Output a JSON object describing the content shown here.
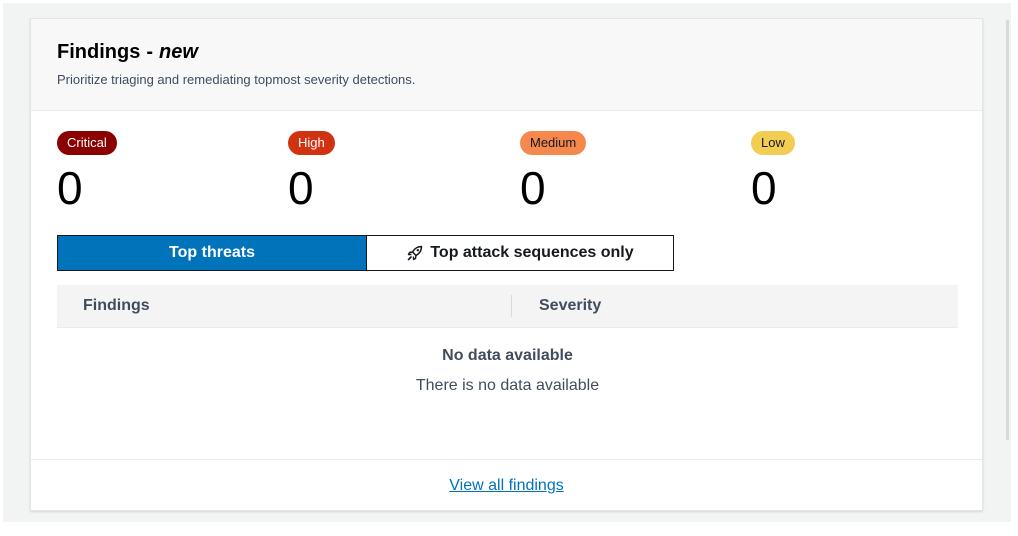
{
  "card": {
    "title": "Findings",
    "title_separator": "-",
    "title_badge": "new",
    "description": "Prioritize triaging and remediating topmost severity detections."
  },
  "severity_counts": [
    {
      "label": "Critical",
      "count": "0",
      "badge_bg": "#8b0000",
      "badge_fg": "#ffffff"
    },
    {
      "label": "High",
      "count": "0",
      "badge_bg": "#d13212",
      "badge_fg": "#ffffff"
    },
    {
      "label": "Medium",
      "count": "0",
      "badge_bg": "#f4884d",
      "badge_fg": "#16191f"
    },
    {
      "label": "Low",
      "count": "0",
      "badge_bg": "#f2cd54",
      "badge_fg": "#16191f"
    }
  ],
  "tabs": [
    {
      "label": "Top threats",
      "active": true
    },
    {
      "label": "Top attack sequences only",
      "active": false,
      "icon": "rocket-icon"
    }
  ],
  "table": {
    "columns": [
      "Findings",
      "Severity"
    ],
    "empty_title": "No data available",
    "empty_text": "There is no data available"
  },
  "footer": {
    "link_label": "View all findings"
  },
  "colors": {
    "accent": "#0073bb",
    "card_header_bg": "#f8f8f8",
    "page_bg": "#f2f3f3"
  }
}
